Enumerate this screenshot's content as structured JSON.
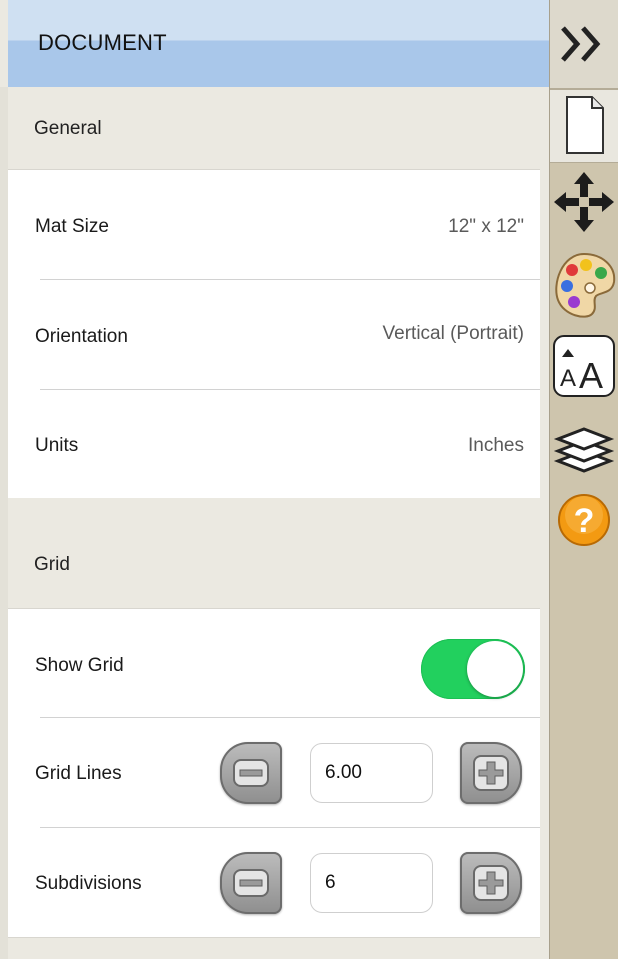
{
  "header": {
    "title": "DOCUMENT"
  },
  "general": {
    "section_title": "General",
    "rows": [
      {
        "label": "Mat Size",
        "value": "12\" x 12\""
      },
      {
        "label": "Orientation",
        "value": "Vertical (Portrait)"
      },
      {
        "label": "Units",
        "value": "Inches"
      }
    ]
  },
  "grid": {
    "section_title": "Grid",
    "show_grid": {
      "label": "Show Grid",
      "on": true
    },
    "grid_lines": {
      "label": "Grid Lines",
      "value": "6.00"
    },
    "subdivisions": {
      "label": "Subdivisions",
      "value": "6"
    }
  },
  "sidebar": {
    "icons": [
      "collapse-icon",
      "document-icon",
      "move-icon",
      "palette-icon",
      "text-size-icon",
      "layers-icon",
      "help-icon"
    ]
  },
  "colors": {
    "header_accent": "#a9c7ea",
    "toggle_on": "#22d05e",
    "sidebar_bg": "#cec5ad",
    "help_orange": "#f39a12"
  }
}
